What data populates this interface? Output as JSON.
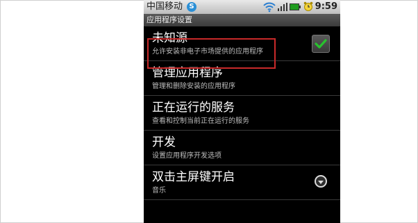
{
  "statusbar": {
    "carrier": "中国移动",
    "skype_glyph": "S",
    "time": "9:59"
  },
  "title": "应用程序设置",
  "items": [
    {
      "title": "未知源",
      "subtitle": "允许安装非电子市场提供的应用程序",
      "control": "checkbox-checked"
    },
    {
      "title": "管理应用程序",
      "subtitle": "管理和删除安装的应用程序",
      "highlighted": true
    },
    {
      "title": "正在运行的服务",
      "subtitle": "查看和控制当前正在运行的服务"
    },
    {
      "title": "开发",
      "subtitle": "设置应用程序开发选项"
    },
    {
      "title": "双击主屏键开启",
      "subtitle": "音乐",
      "control": "dropdown"
    }
  ],
  "colors": {
    "highlight_border": "#c92a2a",
    "check_green": "#28c22e",
    "background": "#000000"
  }
}
